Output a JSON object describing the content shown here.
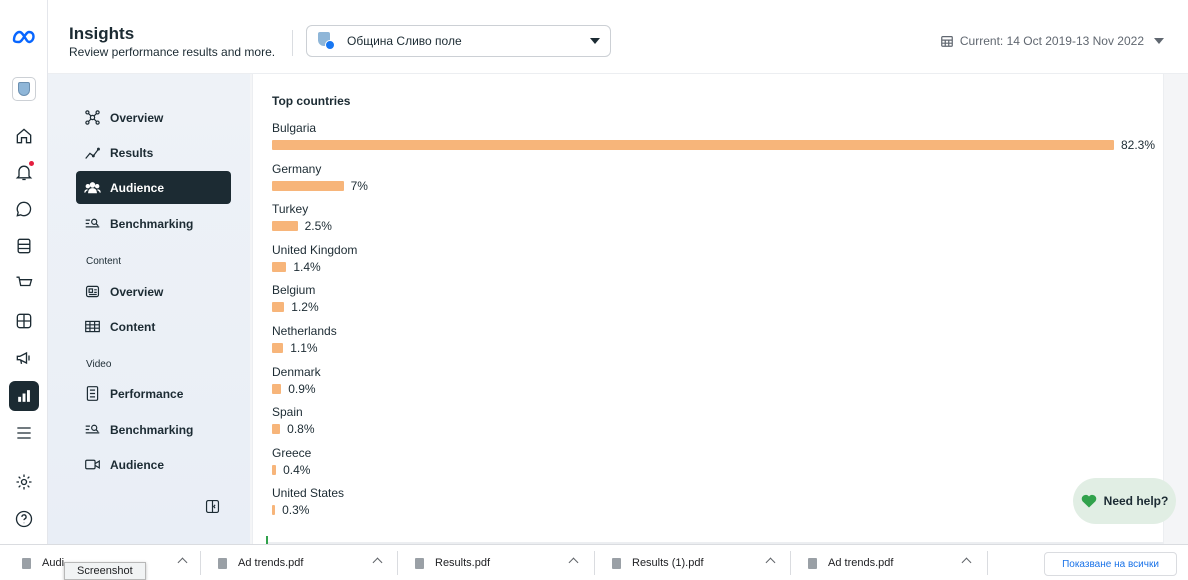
{
  "header": {
    "title": "Insights",
    "subtitle": "Review performance results and more.",
    "page_selector": {
      "value": "Община Сливо поле"
    },
    "date_range": "Current: 14 Oct 2019-13 Nov 2022"
  },
  "rail": {
    "icons": [
      "meta-logo-icon",
      "page-avatar-icon",
      "home-icon",
      "notifications-icon",
      "messages-icon",
      "posts-icon",
      "shop-icon",
      "table-icon",
      "ads-megaphone-icon",
      "insights-icon",
      "menu-icon",
      "settings-icon",
      "help-icon"
    ]
  },
  "nav": {
    "items": [
      {
        "label": "Overview",
        "icon": "overview-nodes-icon"
      },
      {
        "label": "Results",
        "icon": "results-chart-icon"
      },
      {
        "label": "Audience",
        "icon": "people-icon",
        "active": true
      },
      {
        "label": "Benchmarking",
        "icon": "benchmark-icon"
      }
    ],
    "content_section": "Content",
    "content_items": [
      {
        "label": "Overview",
        "icon": "content-overview-icon"
      },
      {
        "label": "Content",
        "icon": "content-table-icon"
      }
    ],
    "video_section": "Video",
    "video_items": [
      {
        "label": "Performance",
        "icon": "performance-icon"
      },
      {
        "label": "Benchmarking",
        "icon": "benchmark-icon"
      },
      {
        "label": "Audience",
        "icon": "video-icon"
      }
    ]
  },
  "card": {
    "title": "Top countries"
  },
  "chart_data": {
    "type": "bar",
    "orientation": "horizontal",
    "title": "Top countries",
    "categories": [
      "Bulgaria",
      "Germany",
      "Turkey",
      "United Kingdom",
      "Belgium",
      "Netherlands",
      "Denmark",
      "Spain",
      "Greece",
      "United States"
    ],
    "values": [
      82.3,
      7,
      2.5,
      1.4,
      1.2,
      1.1,
      0.9,
      0.8,
      0.4,
      0.3
    ],
    "labels": [
      "82.3%",
      "7%",
      "2.5%",
      "1.4%",
      "1.2%",
      "1.1%",
      "0.9%",
      "0.8%",
      "0.4%",
      "0.3%"
    ],
    "bar_color": "#f7b57a",
    "xlim": [
      0,
      82.3
    ],
    "grid": false
  },
  "help": {
    "label": "Need help?"
  },
  "downloads": {
    "items": [
      "Audi",
      "Ad trends.pdf",
      "Results.pdf",
      "Results (1).pdf",
      "Ad trends.pdf"
    ],
    "show_all": "Показване на всички",
    "tooltip": "Screenshot"
  },
  "colors": {
    "accent": "#1c2b33",
    "bar": "#f7b57a",
    "link": "#1a73e8"
  }
}
